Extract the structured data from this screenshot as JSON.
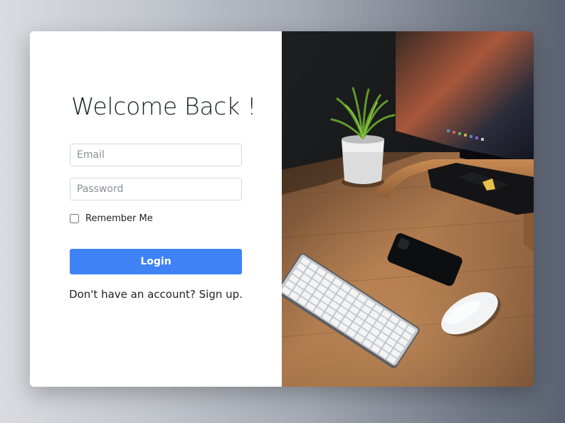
{
  "login": {
    "title": "Welcome Back !",
    "email_placeholder": "Email",
    "password_placeholder": "Password",
    "remember_label": "Remember Me",
    "remember_checked": false,
    "submit_label": "Login",
    "signup_prompt": "Don't have an account?",
    "signup_link": "Sign up."
  },
  "colors": {
    "primary": "#3f82f5",
    "card_bg": "#ffffff",
    "wood": "#9a6a43"
  }
}
